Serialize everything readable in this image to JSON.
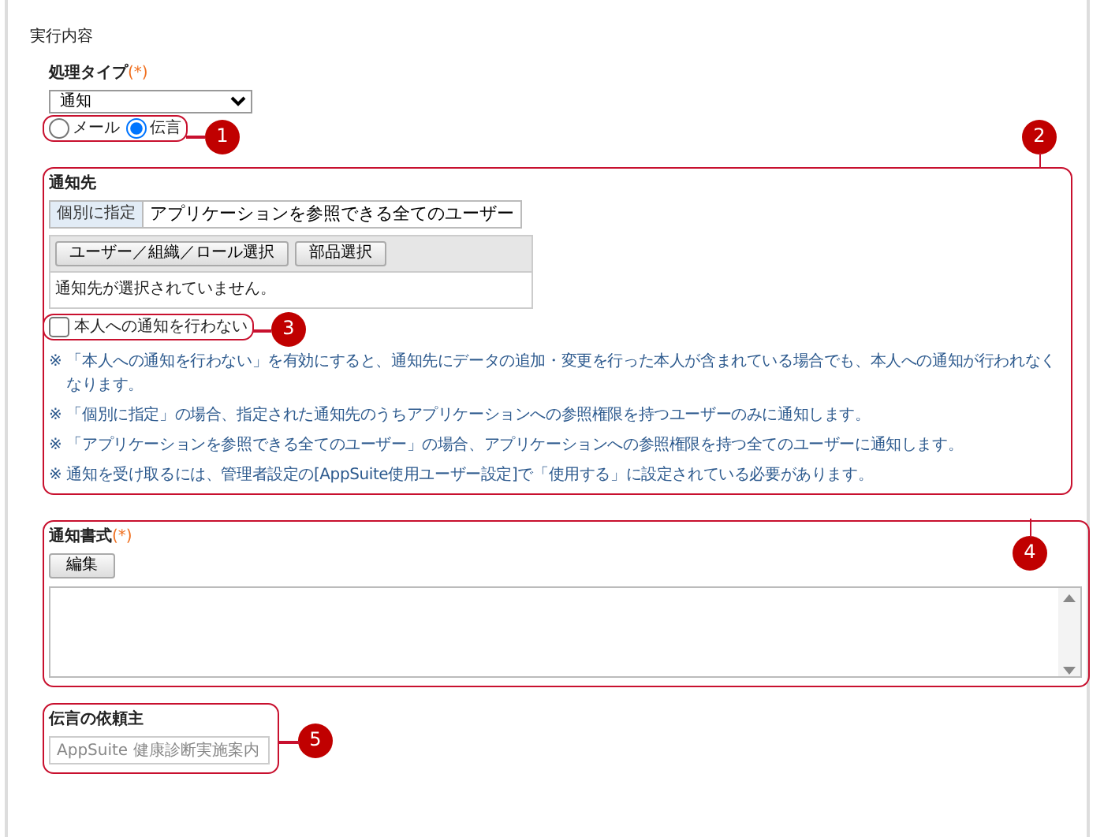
{
  "section_title": "実行内容",
  "process_type": {
    "label": "処理タイプ",
    "required_mark": "(*)",
    "select_value": "通知",
    "callout": "1",
    "radios": [
      {
        "label": "メール",
        "selected": false
      },
      {
        "label": "伝言",
        "selected": true
      }
    ]
  },
  "notify_to": {
    "label": "通知先",
    "callout": "2",
    "toggle": [
      {
        "label": "個別に指定",
        "selected": true
      },
      {
        "label": "アプリケーションを参照できる全てのユーザー",
        "selected": false
      }
    ],
    "select_buttons": [
      "ユーザー／組織／ロール選択",
      "部品選択"
    ],
    "empty_message": "通知先が選択されていません。",
    "self_checkbox": {
      "label": "本人への通知を行わない",
      "checked": false,
      "callout": "3"
    },
    "notes": [
      "※ 「本人への通知を行わない」を有効にすると、通知先にデータの追加・変更を行った本人が含まれている場合でも、本人への通知が行われなくなります。",
      "※ 「個別に指定」の場合、指定された通知先のうちアプリケーションへの参照権限を持つユーザーのみに通知します。",
      "※ 「アプリケーションを参照できる全てのユーザー」の場合、アプリケーションへの参照権限を持つ全てのユーザーに通知します。",
      "※ 通知を受け取るには、管理者設定の[AppSuite使用ユーザー設定]で「使用する」に設定されている必要があります。"
    ]
  },
  "format": {
    "label": "通知書式",
    "required_mark": "(*)",
    "edit_button": "編集",
    "callout": "4"
  },
  "requester": {
    "label": "伝言の依頼主",
    "placeholder": "AppSuite 健康診断実施案内",
    "callout": "5"
  }
}
